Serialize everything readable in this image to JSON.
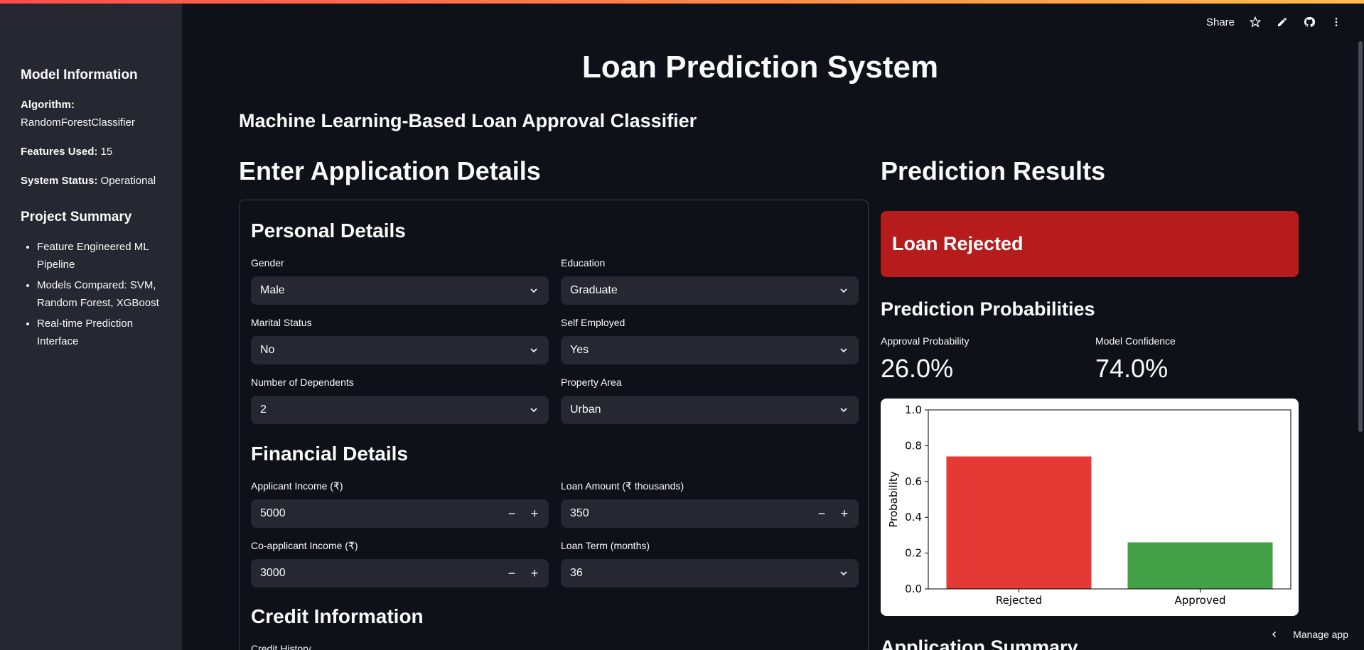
{
  "toolbar": {
    "share_label": "Share",
    "icons": [
      "star-icon",
      "pencil-icon",
      "github-icon",
      "kebab-menu-icon"
    ]
  },
  "sidebar": {
    "model_info_title": "Model Information",
    "algorithm_label": "Algorithm:",
    "algorithm_value": "RandomForestClassifier",
    "features_label": "Features Used:",
    "features_value": "15",
    "status_label": "System Status:",
    "status_value": "Operational",
    "summary_title": "Project Summary",
    "summary_items": [
      "Feature Engineered ML Pipeline",
      "Models Compared: SVM, Random Forest, XGBoost",
      "Real-time Prediction Interface"
    ]
  },
  "main": {
    "title": "Loan Prediction System",
    "subtitle": "Machine Learning-Based Loan Approval Classifier",
    "form_heading": "Enter Application Details",
    "results_heading": "Prediction Results"
  },
  "form": {
    "personal_title": "Personal Details",
    "financial_title": "Financial Details",
    "credit_title": "Credit Information",
    "gender": {
      "label": "Gender",
      "value": "Male"
    },
    "education": {
      "label": "Education",
      "value": "Graduate"
    },
    "marital": {
      "label": "Marital Status",
      "value": "No"
    },
    "self_employed": {
      "label": "Self Employed",
      "value": "Yes"
    },
    "dependents": {
      "label": "Number of Dependents",
      "value": "2"
    },
    "property_area": {
      "label": "Property Area",
      "value": "Urban"
    },
    "applicant_income": {
      "label": "Applicant Income (₹)",
      "value": "5000"
    },
    "loan_amount": {
      "label": "Loan Amount (₹ thousands)",
      "value": "350"
    },
    "coapplicant_income": {
      "label": "Co-applicant Income (₹)",
      "value": "3000"
    },
    "loan_term": {
      "label": "Loan Term (months)",
      "value": "36"
    },
    "credit_history": {
      "label": "Credit History"
    },
    "minus": "−",
    "plus": "+"
  },
  "results": {
    "banner": "Loan Rejected",
    "banner_color": "#b71c1c",
    "probabilities_title": "Prediction Probabilities",
    "approval_label": "Approval Probability",
    "approval_value": "26.0%",
    "confidence_label": "Model Confidence",
    "confidence_value": "74.0%",
    "summary_title": "Application Summary"
  },
  "chart_data": {
    "type": "bar",
    "categories": [
      "Rejected",
      "Approved"
    ],
    "values": [
      0.74,
      0.26
    ],
    "colors": [
      "#e53935",
      "#43a047"
    ],
    "ylabel": "Probability",
    "xlabel": "",
    "ylim": [
      0,
      1.0
    ],
    "yticks": [
      "0.0",
      "0.2",
      "0.4",
      "0.6",
      "0.8",
      "1.0"
    ]
  },
  "footer": {
    "manage_label": "Manage app"
  }
}
